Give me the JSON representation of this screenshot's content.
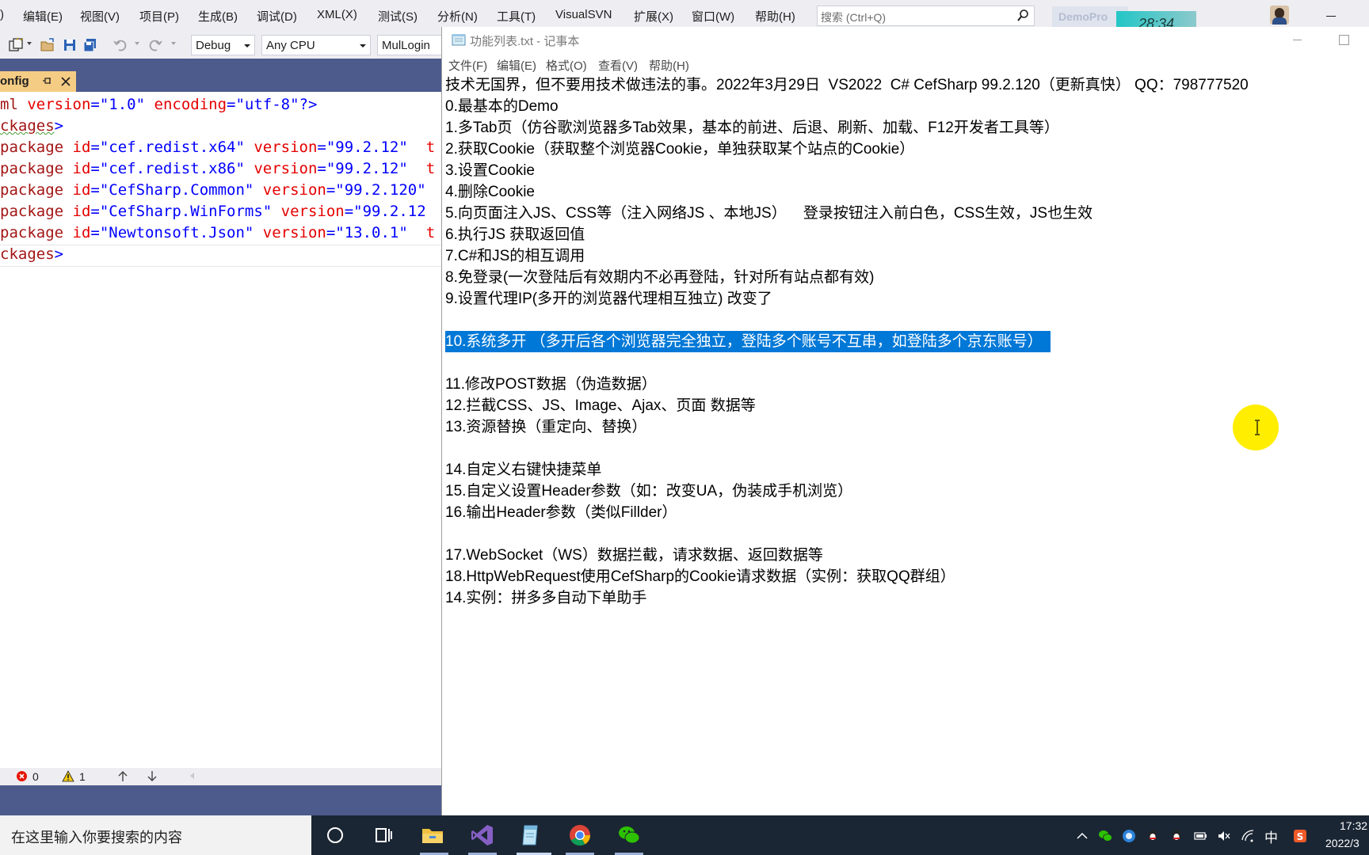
{
  "vs": {
    "menu": [
      "编辑(E)",
      "视图(V)",
      "项目(P)",
      "生成(B)",
      "调试(D)",
      "XML(X)",
      "测试(S)",
      "分析(N)",
      "工具(T)",
      "VisualSVN",
      "扩展(X)",
      "窗口(W)",
      "帮助(H)"
    ],
    "menu_partial": ")",
    "search_placeholder": "搜索 (Ctrl+Q)",
    "project_badge": "DemoPro",
    "timer": "28:34",
    "toolbar": {
      "config": "Debug",
      "platform": "Any CPU",
      "startup_project": "MulLogin"
    },
    "tab": {
      "label": "onfig",
      "pin": "⊕"
    },
    "code": {
      "line1": {
        "a": "ml ",
        "b": "version",
        "c": "=",
        "d": "\"1.0\"",
        "e": " encoding",
        "f": "=",
        "g": "\"utf-8\"",
        "h": "?>"
      },
      "line2": {
        "a": "ckages",
        "b": ">"
      },
      "line3": {
        "a": "package",
        "b": " id",
        "c": "=",
        "d": "\"cef.redist.x64\"",
        "e": " version",
        "f": "=",
        "g": "\"99.2.12\"",
        "h": "  t"
      },
      "line4": {
        "a": "package",
        "b": " id",
        "c": "=",
        "d": "\"cef.redist.x86\"",
        "e": " version",
        "f": "=",
        "g": "\"99.2.12\"",
        "h": "  t"
      },
      "line5": {
        "a": "package",
        "b": " id",
        "c": "=",
        "d": "\"CefSharp.Common\"",
        "e": " version",
        "f": "=",
        "g": "\"99.2.120\"",
        "h": ""
      },
      "line6": {
        "a": "package",
        "b": " id",
        "c": "=",
        "d": "\"CefSharp.WinForms\"",
        "e": " version",
        "f": "=",
        "g": "\"99.2.12",
        "h": ""
      },
      "line7": {
        "a": "package",
        "b": " id",
        "c": "=",
        "d": "\"Newtonsoft.Json\"",
        "e": " version",
        "f": "=",
        "g": "\"13.0.1\"",
        "h": "  t"
      },
      "line8": {
        "a": "ckages",
        "b": ">"
      }
    },
    "errors": {
      "error_count": "0",
      "warning_count": "1"
    }
  },
  "notepad": {
    "title": "功能列表.txt - 记事本",
    "menu": [
      "文件(F)",
      "编辑(E)",
      "格式(O)",
      "查看(V)",
      "帮助(H)"
    ],
    "lines": [
      "技术无国界，但不要用技术做违法的事。2022年3月29日  VS2022  C# CefSharp 99.2.120（更新真快） QQ：798777520",
      "0.最基本的Demo",
      "1.多Tab页（仿谷歌浏览器多Tab效果，基本的前进、后退、刷新、加载、F12开发者工具等）",
      "2.获取Cookie（获取整个浏览器Cookie，单独获取某个站点的Cookie）",
      "3.设置Cookie",
      "4.删除Cookie",
      "5.向页面注入JS、CSS等（注入网络JS 、本地JS）    登录按钮注入前白色，CSS生效，JS也生效",
      "6.执行JS 获取返回值",
      "7.C#和JS的相互调用",
      "8.免登录(一次登陆后有效期内不必再登陆，针对所有站点都有效)",
      "9.设置代理IP(多开的浏览器代理相互独立) 改变了",
      "",
      "10.系统多开 （多开后各个浏览器完全独立，登陆多个账号不互串，如登陆多个京东账号）",
      "",
      "11.修改POST数据（伪造数据）",
      "12.拦截CSS、JS、Image、Ajax、页面 数据等",
      "13.资源替换（重定向、替换）",
      "",
      "14.自定义右键快捷菜单",
      "15.自定义设置Header参数（如：改变UA，伪装成手机浏览）",
      "16.输出Header参数（类似Fillder）",
      "",
      "17.WebSocket（WS）数据拦截，请求数据、返回数据等",
      "18.HttpWebRequest使用CefSharp的Cookie请求数据（实例：获取QQ群组）",
      "14.实例：拼多多自动下单助手"
    ],
    "selected_line_index": 12
  },
  "taskbar": {
    "search_placeholder": "在这里输入你要搜索的内容",
    "apps": [
      "cortana-icon",
      "task-view-icon",
      "file-explorer-icon",
      "visual-studio-icon",
      "notepad-icon",
      "chrome-icon",
      "wechat-icon"
    ],
    "ime": "中",
    "time": "17:32",
    "date": "2022/3"
  },
  "colors": {
    "selection": "#0078d7",
    "vs_tab_active": "#f5cc84",
    "vs_chrome_dark": "#4d5a8c",
    "cursor_highlight": "#ffee00"
  }
}
